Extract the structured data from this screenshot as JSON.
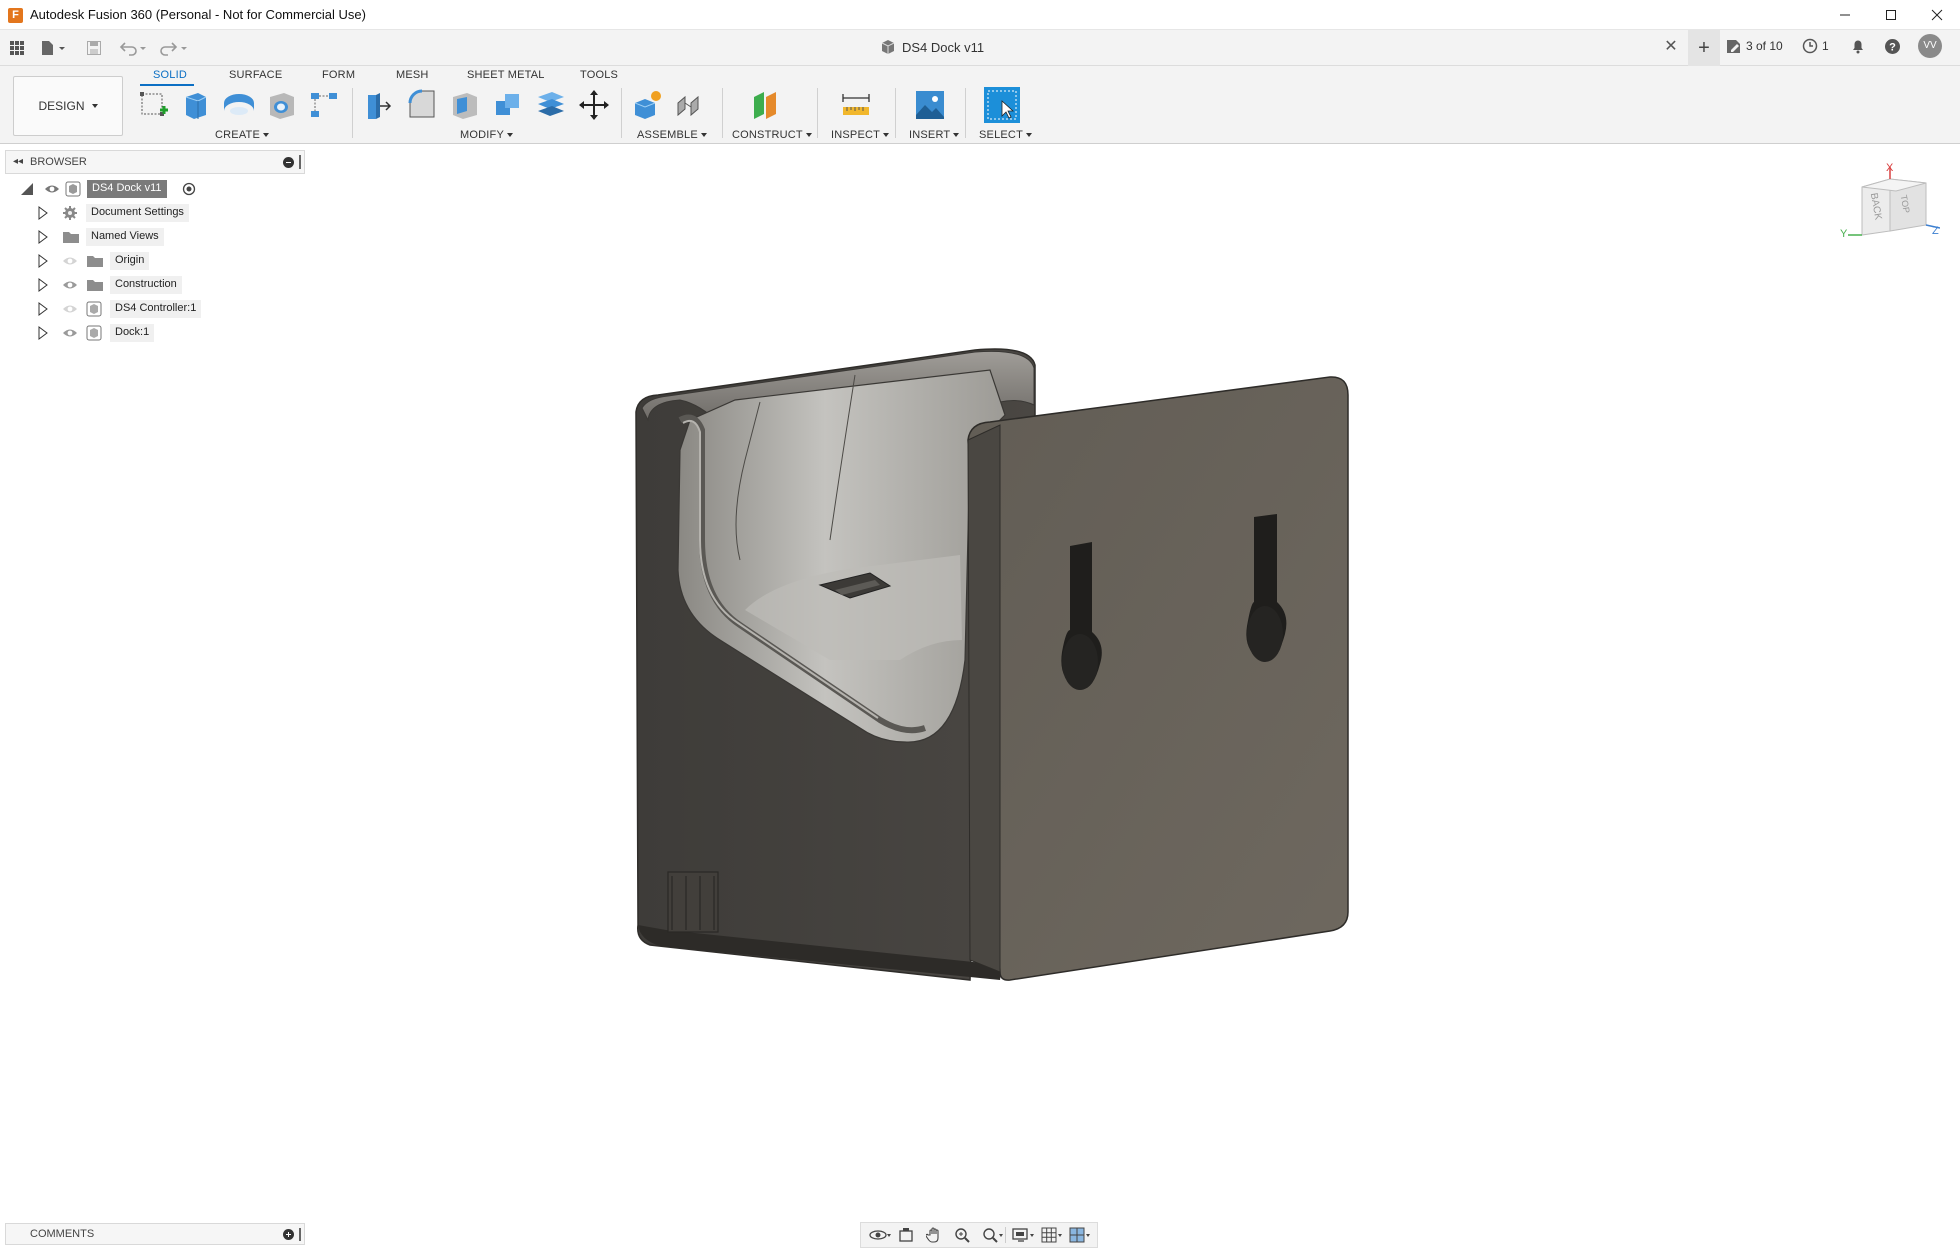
{
  "window": {
    "title": "Autodesk Fusion 360 (Personal - Not for Commercial Use)",
    "app_logo_letter": "F"
  },
  "doc_bar": {
    "doc_title": "DS4 Dock v11",
    "version_label": "3 of 10",
    "jobs_count": "1",
    "user_initials": "VV"
  },
  "ribbon": {
    "workspace_label": "DESIGN",
    "tabs": [
      {
        "label": "SOLID",
        "active": true
      },
      {
        "label": "SURFACE",
        "active": false
      },
      {
        "label": "FORM",
        "active": false
      },
      {
        "label": "MESH",
        "active": false
      },
      {
        "label": "SHEET METAL",
        "active": false
      },
      {
        "label": "TOOLS",
        "active": false
      }
    ],
    "groups": {
      "create": "CREATE",
      "modify": "MODIFY",
      "assemble": "ASSEMBLE",
      "construct": "CONSTRUCT",
      "inspect": "INSPECT",
      "insert": "INSERT",
      "select": "SELECT"
    },
    "accent": "#0b6fc4"
  },
  "browser": {
    "header": "BROWSER",
    "root": "DS4 Dock v11",
    "items": [
      {
        "label": "Document Settings",
        "icon": "gear-icon"
      },
      {
        "label": "Named Views",
        "icon": "folder-icon"
      },
      {
        "label": "Origin",
        "icon": "folder-icon"
      },
      {
        "label": "Construction",
        "icon": "folder-icon"
      },
      {
        "label": "DS4 Controller:1",
        "icon": "component-icon"
      },
      {
        "label": "Dock:1",
        "icon": "component-icon"
      }
    ]
  },
  "viewcube": {
    "face_front": "BACK",
    "face_top": "TOP",
    "axis_x": "X",
    "axis_y": "Y",
    "axis_z": "Z"
  },
  "comments": {
    "header": "COMMENTS"
  },
  "model": {
    "body_color": "#6b655c"
  }
}
